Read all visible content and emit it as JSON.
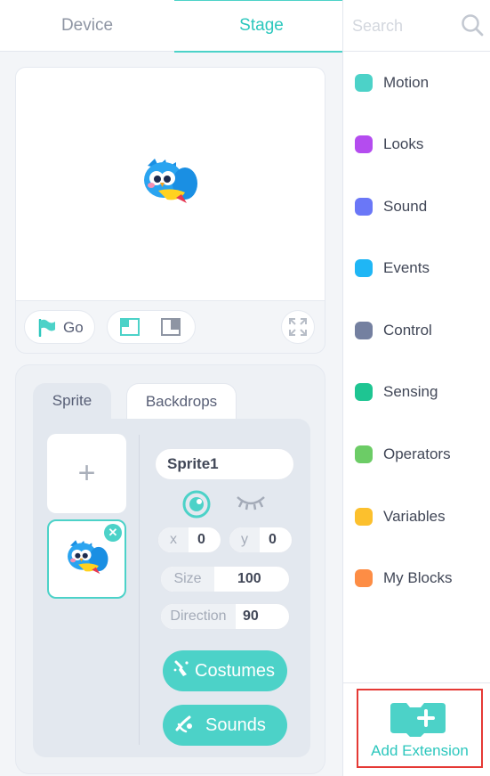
{
  "tabs": {
    "device": "Device",
    "stage": "Stage"
  },
  "stage_controls": {
    "go_label": "Go"
  },
  "sprite_panel": {
    "tab_sprite": "Sprite",
    "tab_backdrops": "Backdrops",
    "add_symbol": "+",
    "delete_symbol": "✕",
    "name": "Sprite1",
    "x_label": "x",
    "x_value": "0",
    "y_label": "y",
    "y_value": "0",
    "size_label": "Size",
    "size_value": "100",
    "direction_label": "Direction",
    "direction_value": "90",
    "costumes_label": "Costumes",
    "sounds_label": "Sounds"
  },
  "palette": {
    "search_placeholder": "Search",
    "categories": [
      {
        "label": "Motion",
        "color": "#4cd2c8"
      },
      {
        "label": "Looks",
        "color": "#b44cef"
      },
      {
        "label": "Sound",
        "color": "#6a77f7"
      },
      {
        "label": "Events",
        "color": "#1fb6f5"
      },
      {
        "label": "Control",
        "color": "#7480a0"
      },
      {
        "label": "Sensing",
        "color": "#1ec592"
      },
      {
        "label": "Operators",
        "color": "#6ccc66"
      },
      {
        "label": "Variables",
        "color": "#fcc02d"
      },
      {
        "label": "My Blocks",
        "color": "#fd8d45"
      }
    ],
    "add_extension": "Add Extension"
  },
  "colors": {
    "accent": "#4cd2c8",
    "highlight": "#e53935"
  }
}
